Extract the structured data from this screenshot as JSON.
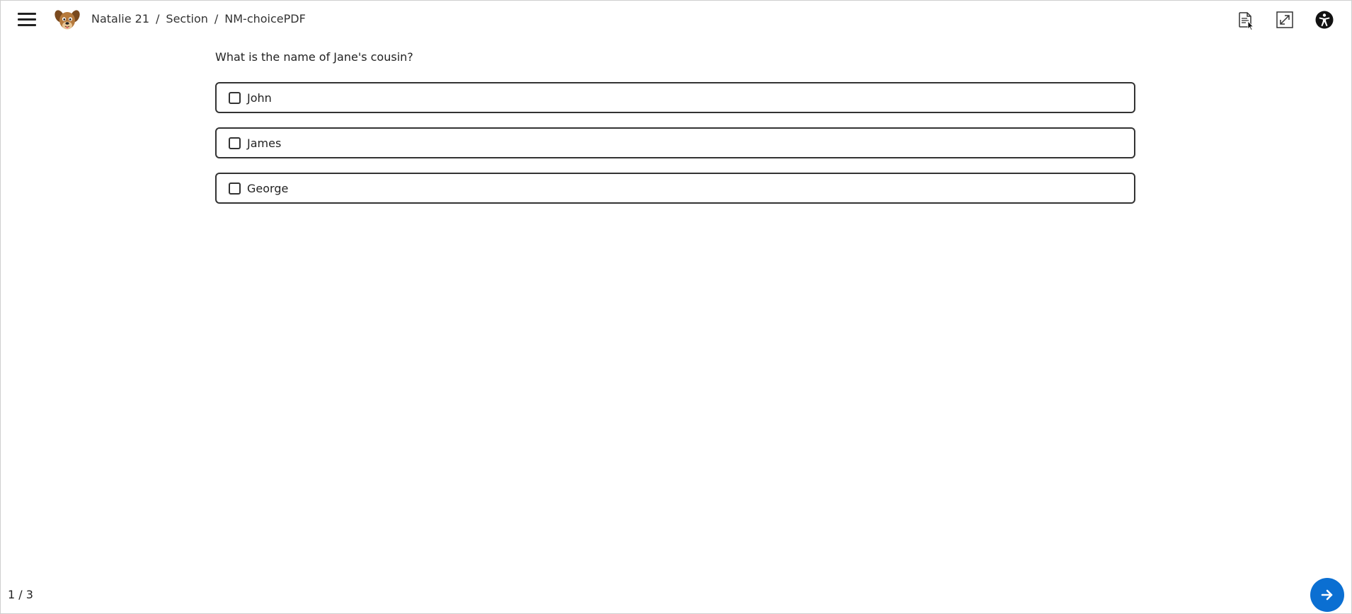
{
  "header": {
    "breadcrumb": [
      {
        "label": "Natalie 21"
      },
      {
        "label": "Section"
      }
    ],
    "current_page": "NM-choicePDF",
    "separator": "/"
  },
  "icons": {
    "menu": "hamburger-menu-icon",
    "avatar": "dog-avatar",
    "document": "document-icon",
    "expand": "expand-icon",
    "accessibility": "accessibility-icon",
    "next": "arrow-right-icon"
  },
  "question": {
    "text": "What is the name of Jane's cousin?",
    "options": [
      {
        "label": "John",
        "checked": false
      },
      {
        "label": "James",
        "checked": false
      },
      {
        "label": "George",
        "checked": false
      }
    ]
  },
  "footer": {
    "pager": "1 / 3"
  },
  "colors": {
    "accent": "#0b6fd2",
    "text": "#222222",
    "border": "#333333"
  }
}
